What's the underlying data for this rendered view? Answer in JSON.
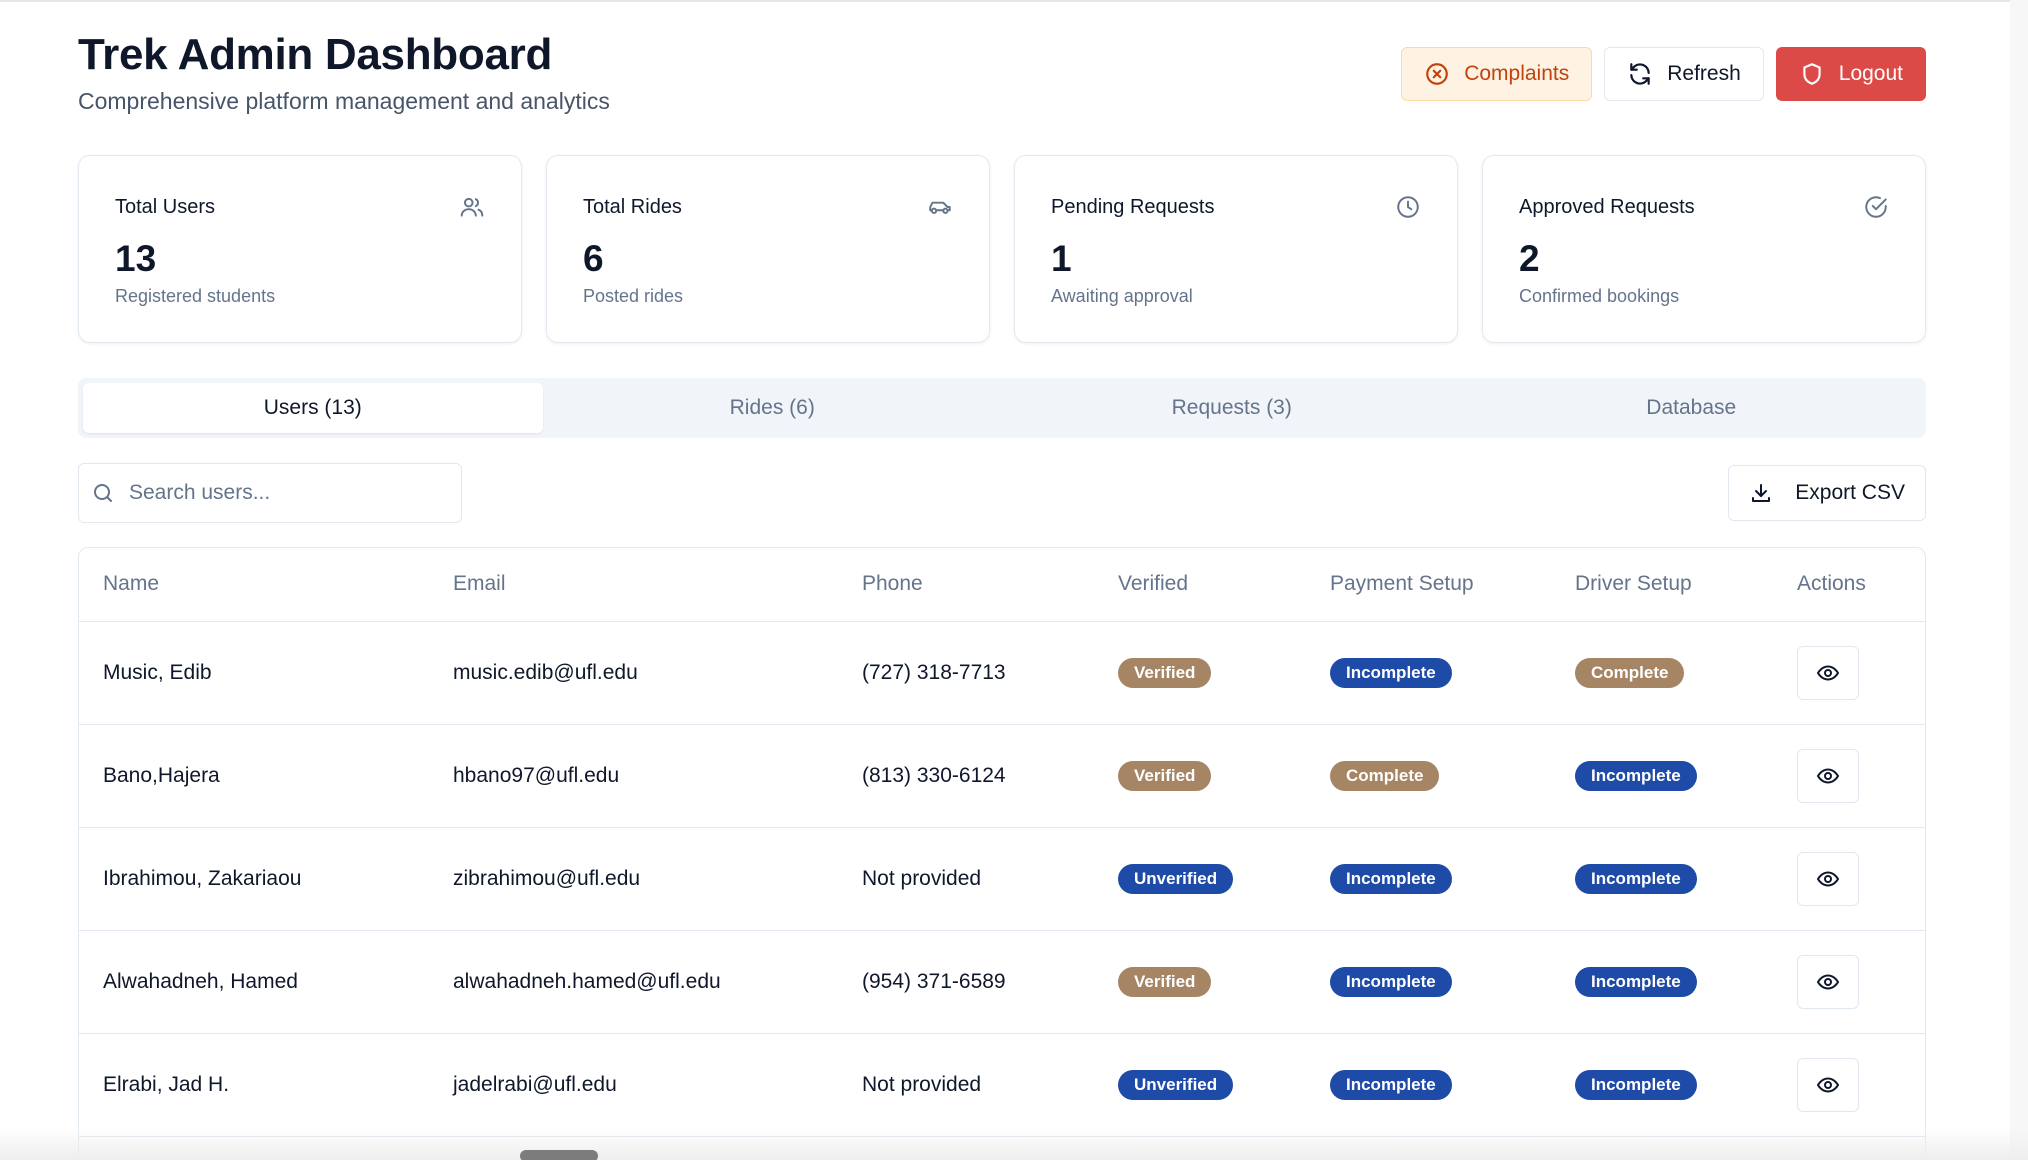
{
  "header": {
    "title": "Trek Admin Dashboard",
    "subtitle": "Comprehensive platform management and analytics",
    "complaints_label": "Complaints",
    "refresh_label": "Refresh",
    "logout_label": "Logout"
  },
  "stats": [
    {
      "title": "Total Users",
      "value": "13",
      "desc": "Registered students",
      "icon": "users-icon"
    },
    {
      "title": "Total Rides",
      "value": "6",
      "desc": "Posted rides",
      "icon": "car-icon"
    },
    {
      "title": "Pending Requests",
      "value": "1",
      "desc": "Awaiting approval",
      "icon": "clock-icon"
    },
    {
      "title": "Approved Requests",
      "value": "2",
      "desc": "Confirmed bookings",
      "icon": "check-circle-icon"
    }
  ],
  "tabs": [
    {
      "label": "Users (13)",
      "active": true
    },
    {
      "label": "Rides (6)",
      "active": false
    },
    {
      "label": "Requests (3)",
      "active": false
    },
    {
      "label": "Database",
      "active": false
    }
  ],
  "search": {
    "placeholder": "Search users...",
    "value": ""
  },
  "export_label": "Export CSV",
  "table": {
    "columns": [
      "Name",
      "Email",
      "Phone",
      "Verified",
      "Payment Setup",
      "Driver Setup",
      "Actions"
    ],
    "rows": [
      {
        "name": "Music, Edib",
        "email": "music.edib@ufl.edu",
        "phone": "(727) 318-7713",
        "verified": "Verified",
        "payment": "Incomplete",
        "driver": "Complete"
      },
      {
        "name": "Bano,Hajera",
        "email": "hbano97@ufl.edu",
        "phone": "(813) 330-6124",
        "verified": "Verified",
        "payment": "Complete",
        "driver": "Incomplete"
      },
      {
        "name": "Ibrahimou, Zakariaou",
        "email": "zibrahimou@ufl.edu",
        "phone": "Not provided",
        "verified": "Unverified",
        "payment": "Incomplete",
        "driver": "Incomplete"
      },
      {
        "name": "Alwahadneh, Hamed",
        "email": "alwahadneh.hamed@ufl.edu",
        "phone": "(954) 371-6589",
        "verified": "Verified",
        "payment": "Incomplete",
        "driver": "Incomplete"
      },
      {
        "name": "Elrabi, Jad H.",
        "email": "jadelrabi@ufl.edu",
        "phone": "Not provided",
        "verified": "Unverified",
        "payment": "Incomplete",
        "driver": "Incomplete"
      }
    ]
  },
  "colors": {
    "badge_positive": "#a68565",
    "badge_negative": "#1e4aa8",
    "logout_bg": "#dc4a48",
    "complaints_bg": "#fef3e2",
    "complaints_text": "#c2410c"
  }
}
